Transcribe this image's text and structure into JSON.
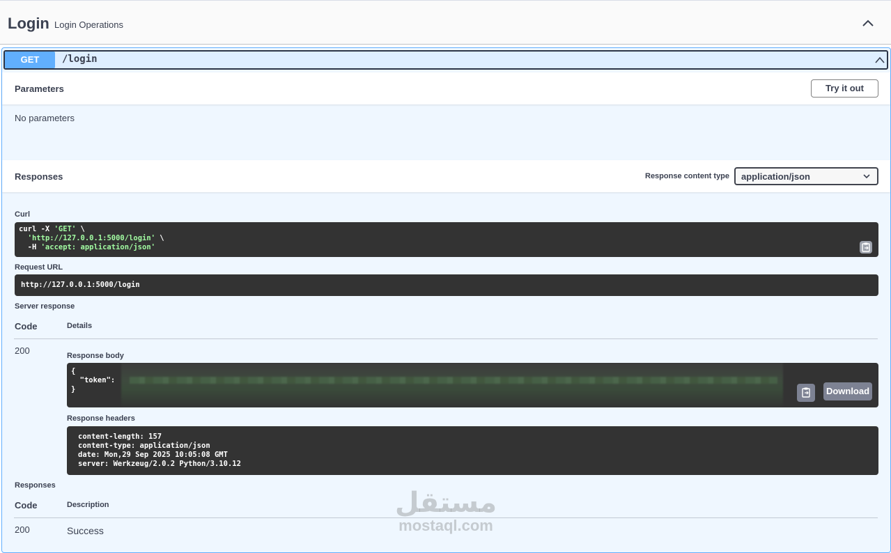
{
  "tag": {
    "title": "Login",
    "description": "Login Operations"
  },
  "operation": {
    "method": "GET",
    "path": "/login"
  },
  "parameters": {
    "title": "Parameters",
    "try_it_out": "Try it out",
    "empty_text": "No parameters"
  },
  "responses_section": {
    "title": "Responses",
    "content_type_label": "Response content type",
    "content_type_value": "application/json"
  },
  "curl": {
    "label": "Curl",
    "line1_cmd": "curl -X ",
    "line1_str": "'GET'",
    "line1_end": " \\",
    "line2_str": "'http://127.0.0.1:5000/login'",
    "line2_end": " \\",
    "line3_cmd": "  -H ",
    "line3_str": "'accept: application/json'"
  },
  "request_url": {
    "label": "Request URL",
    "value": "http://127.0.0.1:5000/login"
  },
  "server_response": {
    "label": "Server response",
    "code_header": "Code",
    "details_header": "Details",
    "code": "200",
    "body_label": "Response body",
    "body_line1": "{",
    "body_line2": "  \"token\":",
    "body_line3": "}",
    "download": "Download",
    "headers_label": "Response headers",
    "headers": [
      "content-length: 157",
      "content-type: application/json",
      "date: Mon,29 Sep 2025 10:05:08 GMT",
      "server: Werkzeug/2.0.2 Python/3.10.12"
    ]
  },
  "responses_table": {
    "label": "Responses",
    "code_header": "Code",
    "description_header": "Description",
    "rows": [
      {
        "code": "200",
        "description": "Success"
      }
    ]
  },
  "watermark": {
    "arabic": "مستقل",
    "latin": "mostaql.com"
  },
  "colors": {
    "get_method": "#61affe",
    "code_bg": "#333333",
    "string": "#a2fca2"
  },
  "icons": {
    "tag_toggle": "chevron-up-icon",
    "summary_toggle": "chevron-up-icon",
    "copy": "clipboard-icon",
    "select": "chevron-down-icon"
  }
}
